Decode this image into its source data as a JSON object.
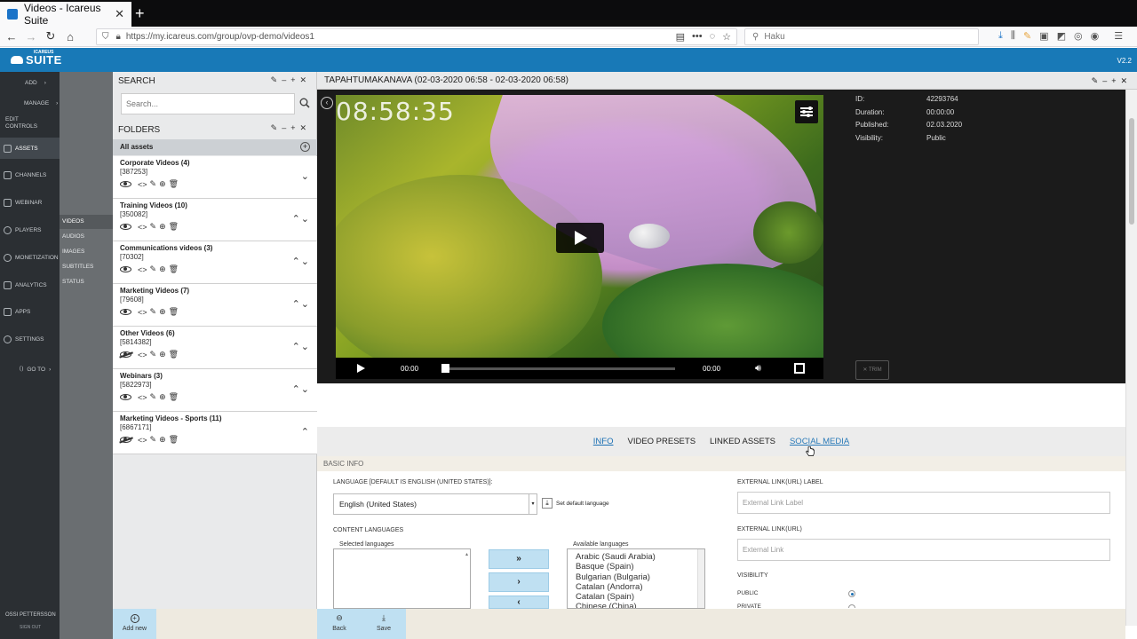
{
  "browser": {
    "tab_title": "Videos - Icareus Suite",
    "tab_close": "✕",
    "new_tab": "+",
    "url_host": "https://my.icareus.com",
    "url_path": "/group/ovp-demo/videos1",
    "search_placeholder": "Haku"
  },
  "app": {
    "logo_small": "ICAREUS",
    "logo": "SUITE",
    "version": "V2.2"
  },
  "leftnav": {
    "items": [
      {
        "label": "ADD",
        "icon": "plus-icon"
      },
      {
        "label": "MANAGE",
        "icon": "manage-icon"
      },
      {
        "label": "EDIT CONTROLS",
        "icon": "edit-icon"
      },
      {
        "label": "ASSETS",
        "icon": "assets-icon"
      },
      {
        "label": "CHANNELS",
        "icon": "channels-icon"
      },
      {
        "label": "WEBINAR",
        "icon": "webinar-icon"
      },
      {
        "label": "PLAYERS",
        "icon": "players-icon"
      },
      {
        "label": "MONETIZATION",
        "icon": "monetization-icon"
      },
      {
        "label": "ANALYTICS",
        "icon": "analytics-icon"
      },
      {
        "label": "APPS",
        "icon": "apps-icon"
      },
      {
        "label": "SETTINGS",
        "icon": "gear-icon"
      },
      {
        "label": "GO TO",
        "icon": "goto-icon"
      }
    ],
    "user": "OSSI PETTERSSON",
    "signout": "SIGN OUT"
  },
  "subnav": {
    "items": [
      "VIDEOS",
      "AUDIOS",
      "IMAGES",
      "SUBTITLES",
      "STATUS"
    ]
  },
  "search": {
    "title": "SEARCH",
    "placeholder": "Search..."
  },
  "folders": {
    "title": "FOLDERS",
    "all_assets": "All assets",
    "items": [
      {
        "name": "Corporate Videos (4)",
        "id": "[387253]",
        "arrows": "⌄"
      },
      {
        "name": "Training Videos (10)",
        "id": "[350082]",
        "arrows": "⌃⌄"
      },
      {
        "name": "Communications videos (3)",
        "id": "[70302]",
        "arrows": "⌃⌄"
      },
      {
        "name": "Marketing Videos (7)",
        "id": "[79608]",
        "arrows": "⌃⌄"
      },
      {
        "name": "Other Videos (6)",
        "id": "[5814382]",
        "arrows": "⌃⌄"
      },
      {
        "name": "Webinars (3)",
        "id": "[5822973]",
        "arrows": "⌃⌄"
      },
      {
        "name": "Marketing Videos - Sports (11)",
        "id": "[6867171]",
        "arrows": "⌃"
      }
    ],
    "add_new": "Add new"
  },
  "asset": {
    "title": "TAPAHTUMAKANAVA (02-03-2020 06:58 - 02-03-2020 06:58)",
    "timecode_overlay": "08:58:35",
    "current_time": "00:00",
    "duration_time": "00:00",
    "meta": [
      {
        "key": "ID:",
        "value": "42293764"
      },
      {
        "key": "Duration:",
        "value": "00:00:00"
      },
      {
        "key": "Published:",
        "value": "02.03.2020"
      },
      {
        "key": "Visibility:",
        "value": "Public"
      }
    ],
    "trim": "✕ TRIM"
  },
  "tabs": [
    "INFO",
    "VIDEO PRESETS",
    "LINKED ASSETS",
    "SOCIAL MEDIA"
  ],
  "form": {
    "section": "BASIC INFO",
    "language_label": "LANGUAGE [DEFAULT IS ENGLISH (UNITED STATES)]:",
    "language_value": "English (United States)",
    "set_default": "Set default language",
    "content_languages": "CONTENT LANGUAGES",
    "selected_languages": "Selected languages",
    "available_languages": "Available languages",
    "available": [
      "Arabic (Saudi Arabia)",
      "Basque (Spain)",
      "Bulgarian (Bulgaria)",
      "Catalan (Andorra)",
      "Catalan (Spain)",
      "Chinese (China)"
    ],
    "btn_all": "»",
    "btn_one": "›",
    "btn_back": "‹",
    "ext_label_label": "EXTERNAL LINK(URL) LABEL",
    "ext_label_placeholder": "External Link Label",
    "ext_url_label": "EXTERNAL LINK(URL)",
    "ext_url_placeholder": "External Link",
    "visibility": "VISIBILITY",
    "public": "PUBLIC",
    "private": "PRIVATE"
  },
  "footer": {
    "back": "Back",
    "save": "Save"
  }
}
